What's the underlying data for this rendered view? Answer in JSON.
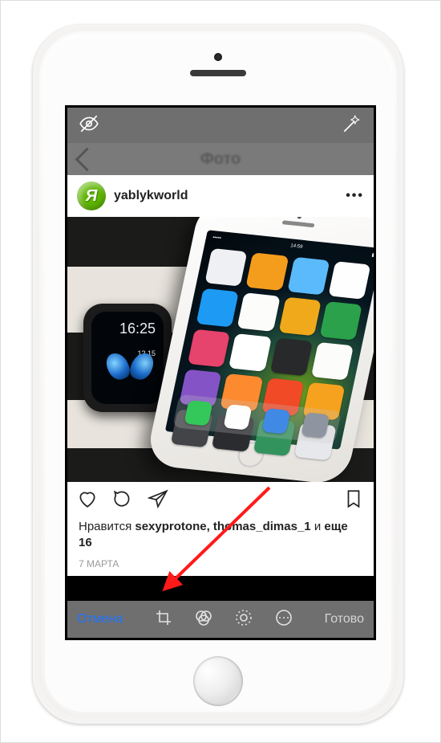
{
  "editor": {
    "header_title": "Фото",
    "top_left_icon": "eye-off",
    "top_right_icon": "magic-wand",
    "cancel_label": "Отмена",
    "done_label": "Готово",
    "tools": [
      "crop",
      "filters",
      "adjust",
      "more"
    ]
  },
  "post": {
    "username": "yablykworld",
    "avatar_letter": "Я",
    "avatar_bg": "#5eb500",
    "likes_prefix": "Нравится",
    "likes_names": "sexyprotone, thomas_dimas_1",
    "likes_and": "и",
    "likes_more": "еще 16",
    "date": "7 МАРТА"
  },
  "photo": {
    "watch_time": "16:25",
    "watch_date": "12 15",
    "status_time": "14:59",
    "app_colors": [
      "#eef0f3",
      "#f49c1c",
      "#5abafc",
      "#fefefe",
      "#1d9af3",
      "#fcfcfa",
      "#efa91a",
      "#2aa14a",
      "#e6436d",
      "#ffffff",
      "#28292b",
      "#fcfcfa",
      "#8454c6",
      "#fe8a2f",
      "#f04a27",
      "#f6a21e",
      "#424447",
      "#2b2c30",
      "#33935c",
      "#e6e8eb"
    ],
    "dock_colors": [
      "#34c759",
      "#fefefe",
      "#4089e4",
      "#8e95a1"
    ]
  },
  "annotation": {
    "arrow_color": "#ff1a1a",
    "arrow_target": "filters-tool"
  }
}
